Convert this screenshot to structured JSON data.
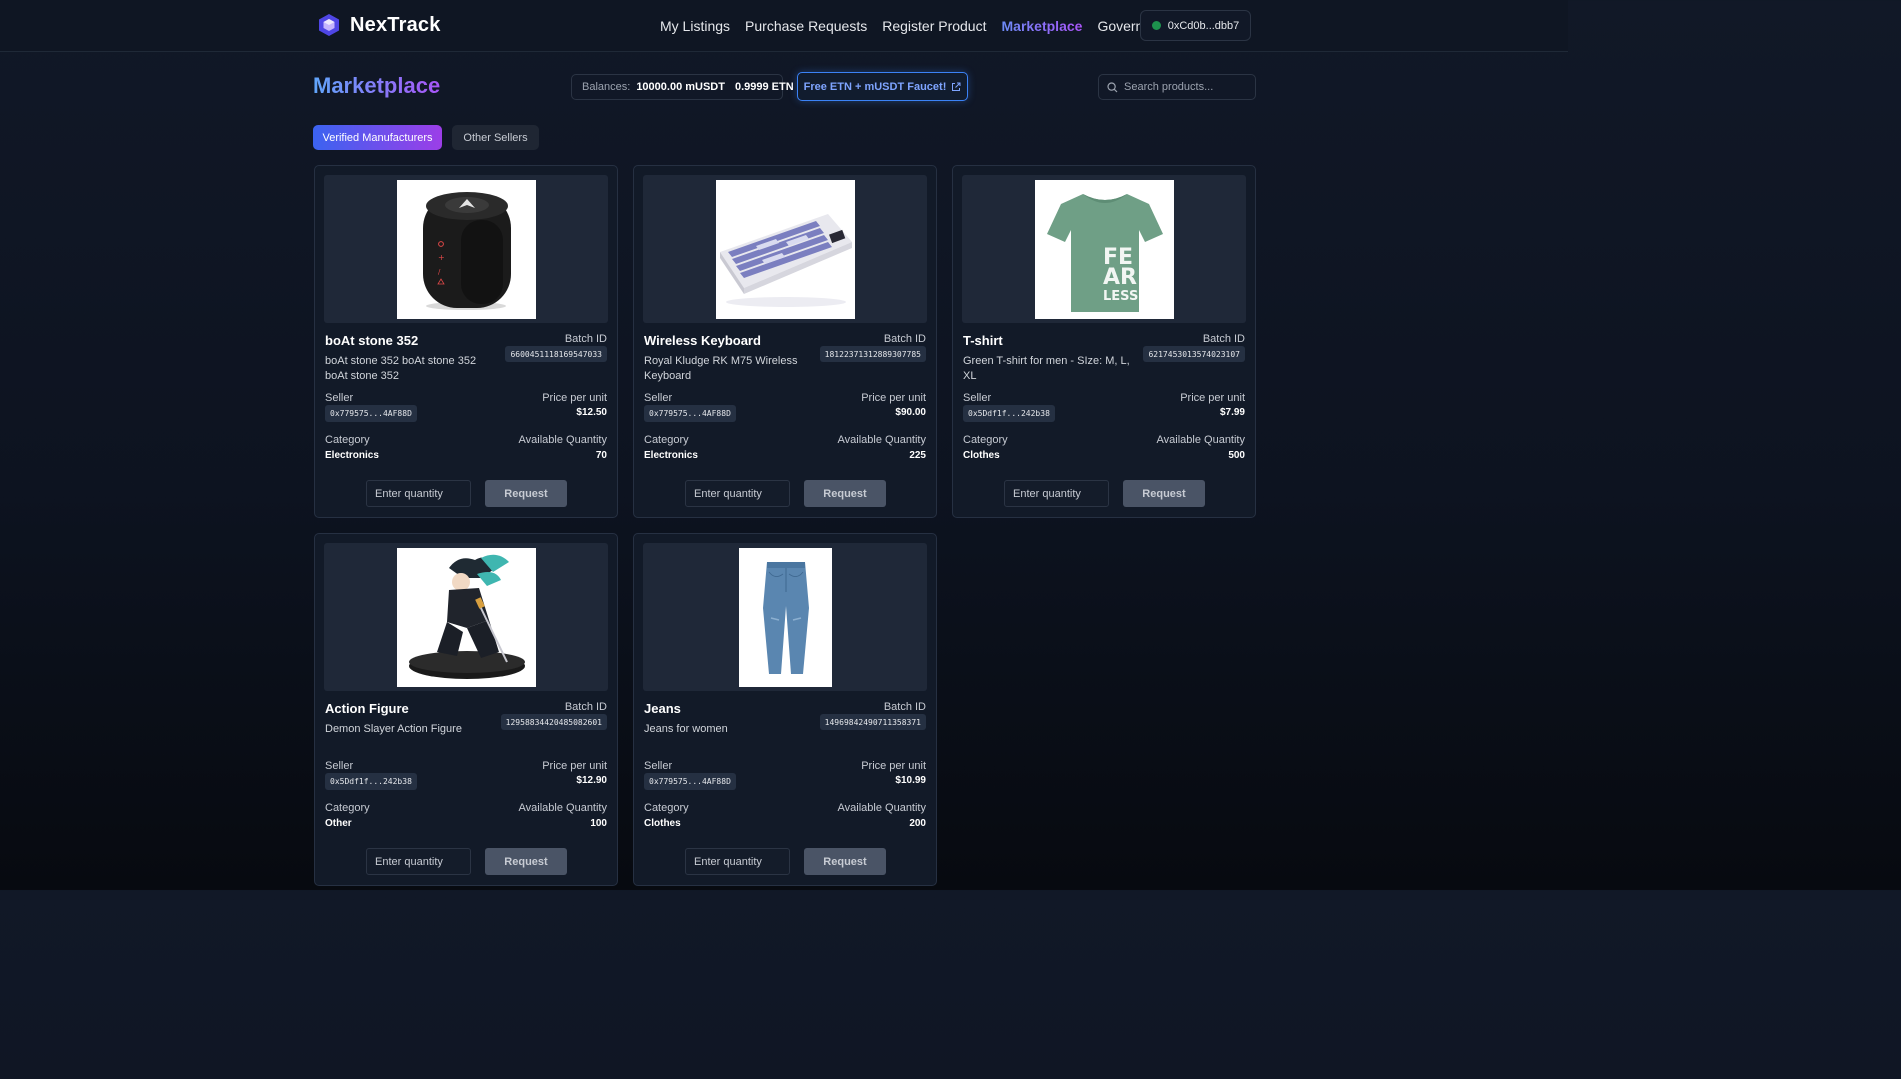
{
  "nav": {
    "brand": "NexTrack",
    "items": [
      "My Listings",
      "Purchase Requests",
      "Register Product",
      "Marketplace",
      "Governance"
    ],
    "active": "Marketplace",
    "wallet": "0xCd0b...dbb7"
  },
  "header": {
    "title": "Marketplace",
    "balances_label": "Balances:",
    "balance_musdt": "10000.00 mUSDT",
    "balance_etn": "0.9999 ETN",
    "faucet_label": "Free ETN + mUSDT Faucet!",
    "search_placeholder": "Search products..."
  },
  "tabs": {
    "verified": "Verified Manufacturers",
    "other": "Other Sellers"
  },
  "labels": {
    "batch": "Batch ID",
    "seller": "Seller",
    "price": "Price per unit",
    "category": "Category",
    "quantity": "Available Quantity",
    "qty_placeholder": "Enter quantity",
    "request": "Request"
  },
  "products": [
    {
      "name": "boAt stone 352",
      "batch_id": "6600451118169547033",
      "description": "boAt stone 352 boAt stone 352 boAt stone 352",
      "seller": "0x779575...4AF88D",
      "price": "$12.50",
      "category": "Electronics",
      "quantity": "70",
      "image": "speaker"
    },
    {
      "name": "Wireless Keyboard",
      "batch_id": "18122371312889307785",
      "description": "Royal Kludge RK M75 Wireless Keyboard",
      "seller": "0x779575...4AF88D",
      "price": "$90.00",
      "category": "Electronics",
      "quantity": "225",
      "image": "keyboard"
    },
    {
      "name": "T-shirt",
      "batch_id": "6217453013574023107",
      "description": "Green T-shirt for men - SIze: M, L, XL",
      "seller": "0x5Ddf1f...242b38",
      "price": "$7.99",
      "category": "Clothes",
      "quantity": "500",
      "image": "tshirt"
    },
    {
      "name": "Action Figure",
      "batch_id": "12958834420485082601",
      "description": "Demon Slayer Action Figure",
      "seller": "0x5Ddf1f...242b38",
      "price": "$12.90",
      "category": "Other",
      "quantity": "100",
      "image": "figure"
    },
    {
      "name": "Jeans",
      "batch_id": "14969842490711358371",
      "description": "Jeans for women",
      "seller": "0x779575...4AF88D",
      "price": "$10.99",
      "category": "Clothes",
      "quantity": "200",
      "image": "jeans"
    }
  ],
  "tshirt_print": "FE AR LESS"
}
